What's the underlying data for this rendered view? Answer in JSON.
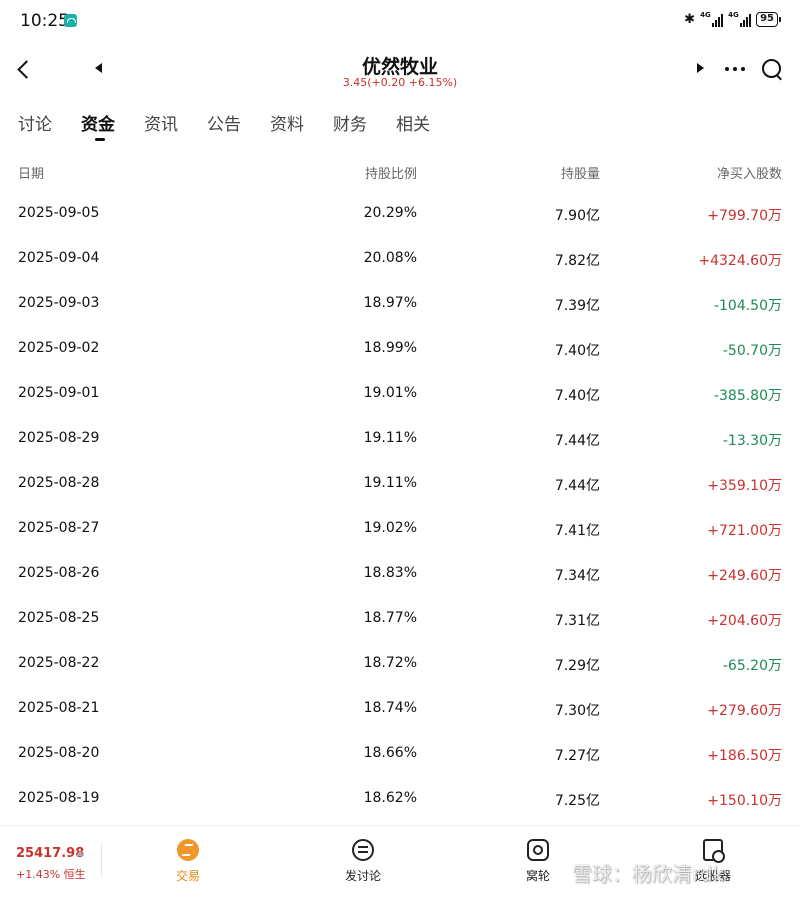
{
  "status": {
    "time": "10:25",
    "battery": "95",
    "network": "4G"
  },
  "header": {
    "title": "优然牧业",
    "quote": "3.45(+0.20 +6.15%)"
  },
  "tabs": [
    {
      "label": "讨论"
    },
    {
      "label": "资金"
    },
    {
      "label": "资讯"
    },
    {
      "label": "公告"
    },
    {
      "label": "资料"
    },
    {
      "label": "财务"
    },
    {
      "label": "相关"
    }
  ],
  "active_tab": "资金",
  "table": {
    "headers": {
      "date": "日期",
      "ratio": "持股比例",
      "qty": "持股量",
      "net": "净买入股数"
    },
    "rows": [
      {
        "date": "2025-09-05",
        "ratio": "20.29%",
        "qty": "7.90亿",
        "net": "+799.70万"
      },
      {
        "date": "2025-09-04",
        "ratio": "20.08%",
        "qty": "7.82亿",
        "net": "+4324.60万"
      },
      {
        "date": "2025-09-03",
        "ratio": "18.97%",
        "qty": "7.39亿",
        "net": "-104.50万"
      },
      {
        "date": "2025-09-02",
        "ratio": "18.99%",
        "qty": "7.40亿",
        "net": "-50.70万"
      },
      {
        "date": "2025-09-01",
        "ratio": "19.01%",
        "qty": "7.40亿",
        "net": "-385.80万"
      },
      {
        "date": "2025-08-29",
        "ratio": "19.11%",
        "qty": "7.44亿",
        "net": "-13.30万"
      },
      {
        "date": "2025-08-28",
        "ratio": "19.11%",
        "qty": "7.44亿",
        "net": "+359.10万"
      },
      {
        "date": "2025-08-27",
        "ratio": "19.02%",
        "qty": "7.41亿",
        "net": "+721.00万"
      },
      {
        "date": "2025-08-26",
        "ratio": "18.83%",
        "qty": "7.34亿",
        "net": "+249.60万"
      },
      {
        "date": "2025-08-25",
        "ratio": "18.77%",
        "qty": "7.31亿",
        "net": "+204.60万"
      },
      {
        "date": "2025-08-22",
        "ratio": "18.72%",
        "qty": "7.29亿",
        "net": "-65.20万"
      },
      {
        "date": "2025-08-21",
        "ratio": "18.74%",
        "qty": "7.30亿",
        "net": "+279.60万"
      },
      {
        "date": "2025-08-20",
        "ratio": "18.66%",
        "qty": "7.27亿",
        "net": "+186.50万"
      },
      {
        "date": "2025-08-19",
        "ratio": "18.62%",
        "qty": "7.25亿",
        "net": "+150.10万"
      }
    ]
  },
  "bottom": {
    "index_value": "25417.98",
    "index_change": "+1.43% 恒生",
    "nav": [
      {
        "label": "交易",
        "icon": "trade-icon"
      },
      {
        "label": "发讨论",
        "icon": "discuss-icon"
      },
      {
        "label": "窝轮",
        "icon": "wheel-icon"
      },
      {
        "label": "选股器",
        "icon": "screener-icon"
      }
    ]
  },
  "watermark": "雪球：杨欣清rdk",
  "colors": {
    "up": "#c8322f",
    "down": "#1e8a55",
    "accent": "#f0962a"
  }
}
